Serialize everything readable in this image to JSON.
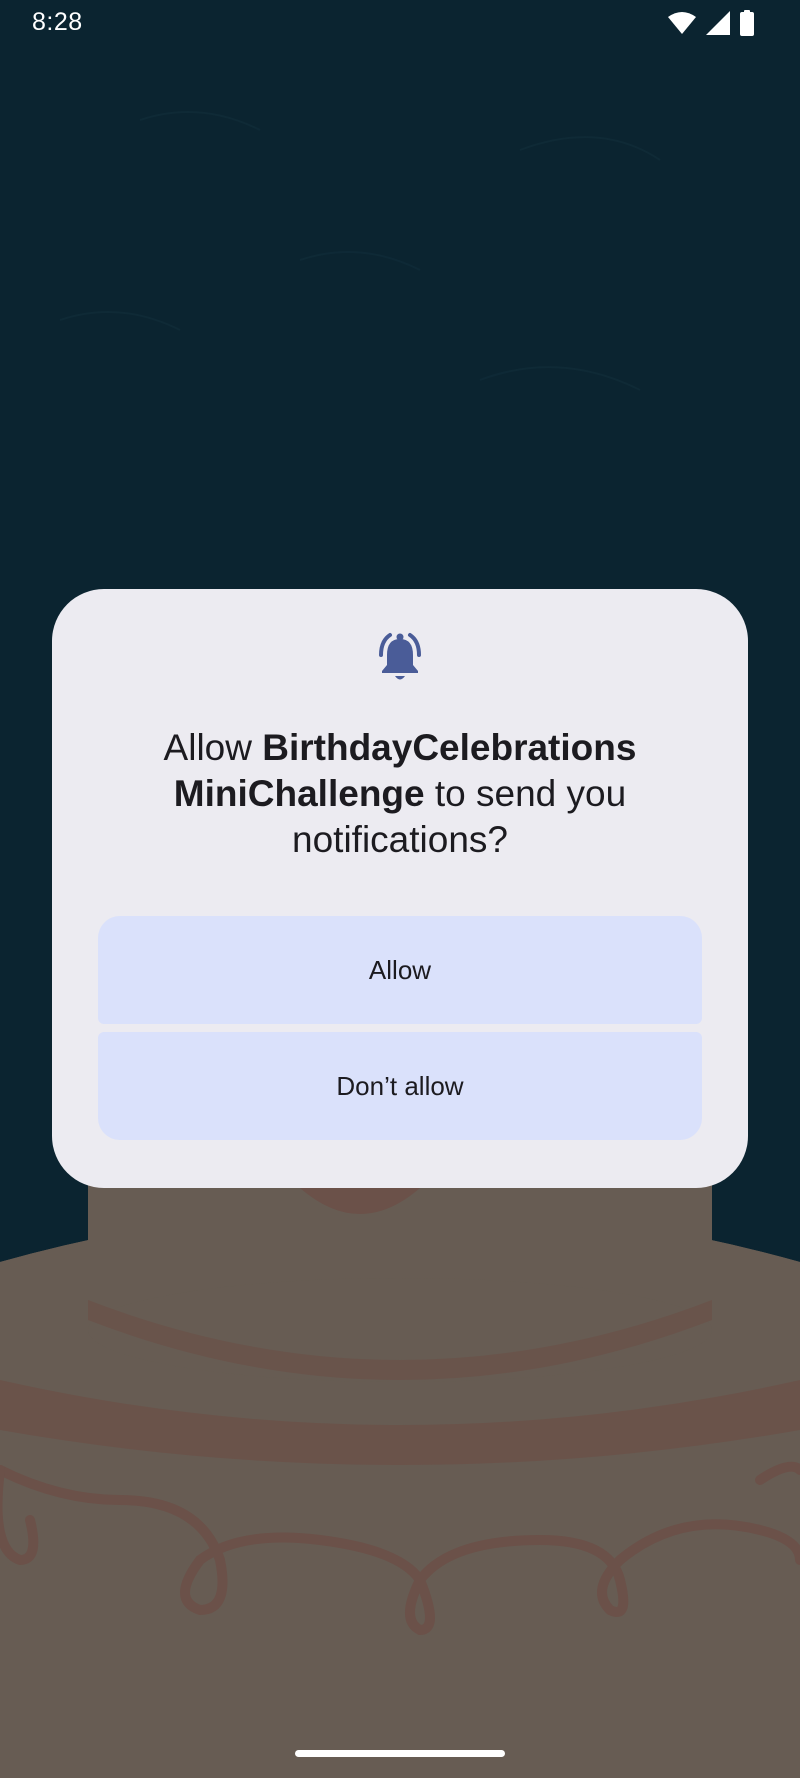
{
  "status_bar": {
    "time": "8:28",
    "icons": [
      "wifi-icon",
      "cellular-signal-icon",
      "battery-icon"
    ]
  },
  "dialog": {
    "icon": "notification-bell-icon",
    "title_prefix": "Allow ",
    "app_name_line1": "BirthdayCelebrations",
    "app_name_line2": "MiniChallenge",
    "title_suffix": " to send you notifications?",
    "allow_label": "Allow",
    "deny_label": "Don’t allow"
  },
  "colors": {
    "background": "#0b2430",
    "dialog_surface": "#ecebf1",
    "button_fill": "#dae1fb",
    "icon_accent": "#4a5c98",
    "cake_body": "#675c53",
    "cake_icing": "#6b5149"
  }
}
